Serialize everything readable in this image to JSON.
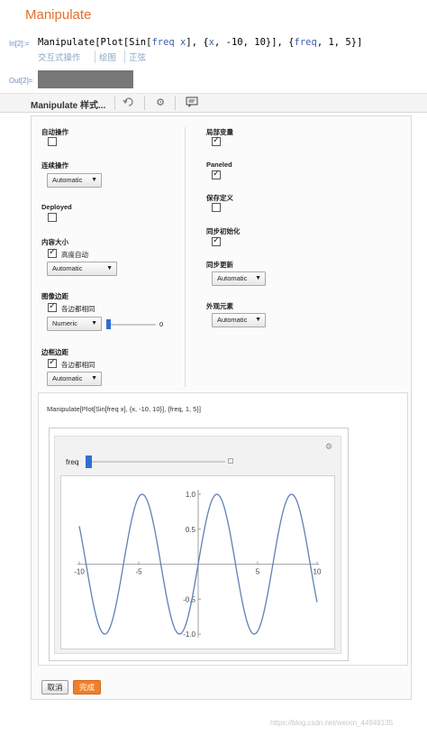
{
  "cell": {
    "title": "Manipulate",
    "in_label": "In[2]:=",
    "code_prefix": "Manipulate[Plot[Sin[",
    "code_var1": "freq x",
    "code_mid": "], {",
    "code_var2": "x",
    "code_mid2": ", -10, 10}], {",
    "code_var3": "freq",
    "code_suffix": ", 1, 5}]",
    "suggestions": [
      "交互式操作",
      "绘图",
      "正弦"
    ],
    "out_label": "Out[2]="
  },
  "toolbar": {
    "title": "Manipulate 样式...",
    "icons": [
      "undo-icon",
      "gear-icon",
      "comment-icon"
    ]
  },
  "options_left": {
    "auto_action": {
      "label": "自动操作",
      "checked": false
    },
    "continuous": {
      "label": "连续操作",
      "value": "Automatic"
    },
    "deployed": {
      "label": "Deployed",
      "checked": false
    },
    "content_size": {
      "label": "内容大小",
      "check_label": "高度自动",
      "checked": true,
      "value": "Automatic"
    },
    "image_margins": {
      "label": "图像边距",
      "check_label": "各边都相同",
      "checked": true,
      "value": "Numeric",
      "slider_value": "0"
    },
    "frame_margins": {
      "label": "边框边距",
      "check_label": "各边都相同",
      "checked": true,
      "value": "Automatic"
    }
  },
  "options_right": {
    "local_vars": {
      "label": "局部变量",
      "checked": true
    },
    "paneled": {
      "label": "Paneled",
      "checked": true
    },
    "save_defs": {
      "label": "保存定义",
      "checked": false
    },
    "sync_init": {
      "label": "同步初始化",
      "checked": true
    },
    "sync_update": {
      "label": "同步更新",
      "value": "Automatic"
    },
    "appearance": {
      "label": "外观元素",
      "value": "Automatic"
    }
  },
  "output": {
    "expression": "Manipulate[Plot[Sin[freq x], {x, -10, 10}], {freq, 1, 5}]",
    "control_label": "freq",
    "freq_value": 1
  },
  "chart_data": {
    "type": "line",
    "function": "Sin[freq x]",
    "freq": 1,
    "xlim": [
      -10,
      10
    ],
    "ylim": [
      -1,
      1
    ],
    "x_ticks": [
      "-10",
      "-5",
      "5",
      "10"
    ],
    "y_ticks": [
      "1.0",
      "0.5",
      "-0.5",
      "-1.0"
    ],
    "title": "",
    "xlabel": "",
    "ylabel": "",
    "color": "#5e81b5"
  },
  "buttons": {
    "cancel": "取消",
    "done": "完成"
  },
  "watermark": "https://blog.csdn.net/weixin_44949135"
}
